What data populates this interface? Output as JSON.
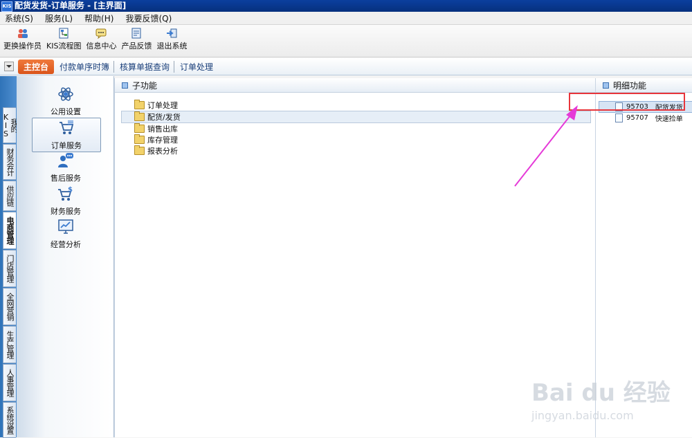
{
  "window": {
    "title": "配货发货-订单服务 - [主界面]",
    "logo": "KIS"
  },
  "menu": [
    "系统(S)",
    "服务(L)",
    "帮助(H)",
    "我要反馈(Q)"
  ],
  "toolbar": [
    {
      "label": "更换操作员",
      "icon": "users-icon"
    },
    {
      "label": "KIS流程图",
      "icon": "flowchart-icon"
    },
    {
      "label": "信息中心",
      "icon": "message-icon"
    },
    {
      "label": "产品反馈",
      "icon": "feedback-icon"
    },
    {
      "label": "退出系统",
      "icon": "exit-icon"
    }
  ],
  "tabs": {
    "active": "主控台",
    "items": [
      "付款单序时簿",
      "核算单据查询",
      "订单处理"
    ]
  },
  "side_tabs": [
    "我的KIS",
    "财务会计",
    "供应链",
    "电商管理",
    "门店管理",
    "全网营销",
    "生产管理",
    "人事管理",
    "系统设置"
  ],
  "nav": [
    {
      "label": "公用设置",
      "icon": "gear-atom-icon"
    },
    {
      "label": "订单服务",
      "icon": "cart-list-icon"
    },
    {
      "label": "售后服务",
      "icon": "user-chat-icon"
    },
    {
      "label": "财务服务",
      "icon": "cart-dollar-icon"
    },
    {
      "label": "经营分析",
      "icon": "chart-monitor-icon"
    }
  ],
  "sub_panel": {
    "title": "子功能",
    "items": [
      "订单处理",
      "配货/发货",
      "销售出库",
      "库存管理",
      "报表分析"
    ]
  },
  "detail_panel": {
    "title": "明细功能",
    "items": [
      {
        "code": "95703",
        "label": "配货发货"
      },
      {
        "code": "95707",
        "label": "快速捡单"
      }
    ]
  },
  "watermark": {
    "main": "Bai du 经验",
    "sub": "jingyan.baidu.com"
  },
  "colors": {
    "title_bar": "#0b3f9e",
    "active_tab": "#e2642a",
    "highlight_box": "#e8353b",
    "arrow": "#e53ad8"
  }
}
